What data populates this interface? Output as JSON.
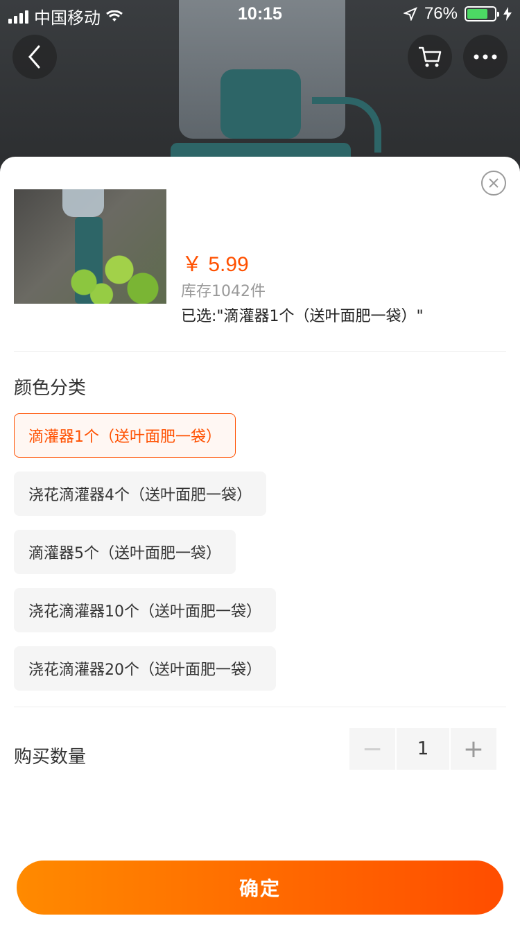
{
  "statusbar": {
    "carrier": "中国移动",
    "time": "10:15",
    "battery_pct": "76%",
    "battery_level": 0.76
  },
  "header": {
    "back_icon": "chevron-left-icon",
    "cart_icon": "cart-icon",
    "more_icon": "more-dots-icon"
  },
  "product": {
    "price": "￥ 5.99",
    "stock": "库存1042件",
    "selected": "已选:\"滴灌器1个（送叶面肥一袋）\""
  },
  "options_section": {
    "title": "颜色分类",
    "items": [
      {
        "label": "滴灌器1个（送叶面肥一袋）",
        "active": true
      },
      {
        "label": "浇花滴灌器4个（送叶面肥一袋）",
        "active": false
      },
      {
        "label": "滴灌器5个（送叶面肥一袋）",
        "active": false
      },
      {
        "label": "浇花滴灌器10个（送叶面肥一袋）",
        "active": false
      },
      {
        "label": "浇花滴灌器20个（送叶面肥一袋）",
        "active": false
      }
    ]
  },
  "quantity": {
    "label": "购买数量",
    "value": "1",
    "minus": "−",
    "plus": "+"
  },
  "confirm_label": "确定",
  "colors": {
    "accent": "#ff5000",
    "button_start": "#ff8a00",
    "button_end": "#ff4d00"
  }
}
